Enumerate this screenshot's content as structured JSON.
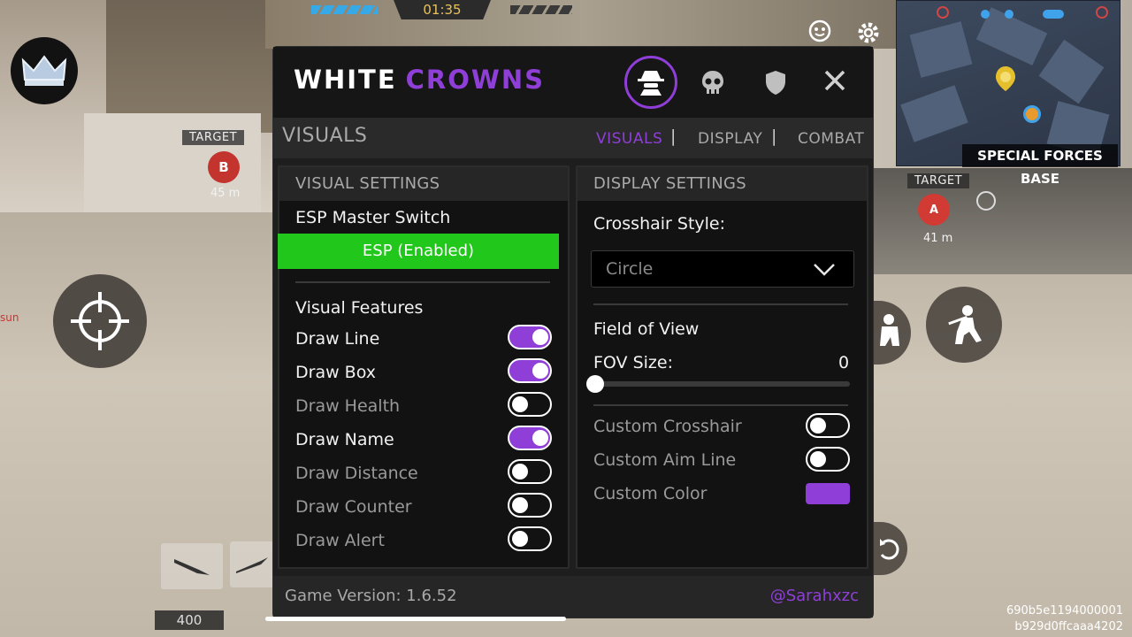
{
  "hud": {
    "timer": "01:35",
    "target_label_left": "TARGET",
    "target_letter_left": "B",
    "target_distance_left": "45 m",
    "target_label_right": "TARGET",
    "target_letter_right": "A",
    "target_distance_right": "41 m",
    "minimap_location": "SPECIAL FORCES BASE",
    "ammo_count": "400",
    "side_stub_text": "sun",
    "session_id_line1": "690b5e1194000001",
    "session_id_line2": "b929d0ffcaaa4202"
  },
  "modal": {
    "brand_white": "WHITE",
    "brand_purple": "CROWNS",
    "header_icons": [
      "spy-icon",
      "skull-icon",
      "shield-icon",
      "close-icon"
    ],
    "section_title": "VISUALS",
    "tabs": [
      {
        "label": "VISUALS",
        "active": true
      },
      {
        "label": "DISPLAY",
        "active": false
      },
      {
        "label": "COMBAT",
        "active": false
      }
    ],
    "tab_separator": "|",
    "accent_color": "#8f3fd8",
    "enabled_color": "#22c71b"
  },
  "visual_settings": {
    "heading": "VISUAL SETTINGS",
    "esp_master_label": "ESP Master Switch",
    "esp_button_label": "ESP (Enabled)",
    "features_label": "Visual Features",
    "features": [
      {
        "label": "Draw Line",
        "enabled": true
      },
      {
        "label": "Draw Box",
        "enabled": true
      },
      {
        "label": "Draw Health",
        "enabled": false
      },
      {
        "label": "Draw Name",
        "enabled": true
      },
      {
        "label": "Draw Distance",
        "enabled": false
      },
      {
        "label": "Draw Counter",
        "enabled": false
      },
      {
        "label": "Draw Alert",
        "enabled": false
      }
    ]
  },
  "display_settings": {
    "heading": "DISPLAY SETTINGS",
    "crosshair_label": "Crosshair Style:",
    "crosshair_value": "Circle",
    "fov_section_label": "Field of View",
    "fov_size_label": "FOV Size:",
    "fov_value": "0",
    "options": [
      {
        "label": "Custom Crosshair",
        "enabled": false
      },
      {
        "label": "Custom Aim Line",
        "enabled": false
      }
    ],
    "custom_color_label": "Custom Color",
    "custom_color_value": "#8f3fd8"
  },
  "footer": {
    "version": "Game Version: 1.6.52",
    "credit": "@Sarahxzc"
  }
}
